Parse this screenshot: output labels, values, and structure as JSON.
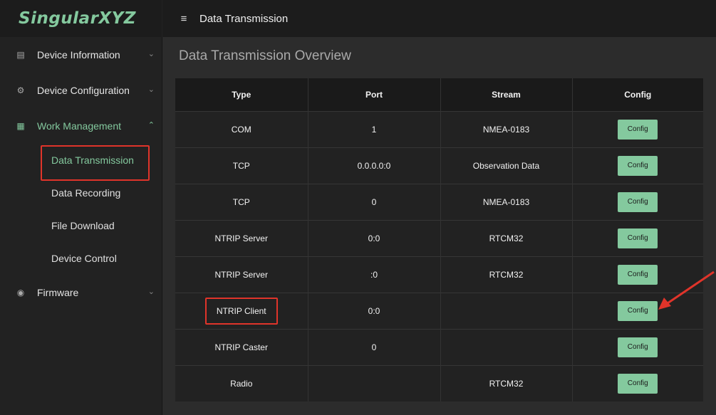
{
  "app": {
    "logo": "SingularXYZ",
    "top_title": "Data Transmission"
  },
  "sidebar": {
    "groups": [
      {
        "label": "Device Information",
        "icon": "device-info-icon",
        "expanded": false
      },
      {
        "label": "Device Configuration",
        "icon": "gear-icon",
        "expanded": false
      },
      {
        "label": "Work Management",
        "icon": "work-icon",
        "expanded": true,
        "children": [
          "Data Transmission",
          "Data Recording",
          "File Download",
          "Device Control"
        ],
        "active_child": "Data Transmission"
      },
      {
        "label": "Firmware",
        "icon": "firmware-icon",
        "expanded": false
      }
    ]
  },
  "main": {
    "title": "Data Transmission Overview",
    "columns": [
      "Type",
      "Port",
      "Stream",
      "Config"
    ],
    "rows": [
      {
        "type": "COM",
        "port": "1",
        "stream": "NMEA-0183",
        "config": "Config"
      },
      {
        "type": "TCP",
        "port": "0.0.0.0:0",
        "stream": "Observation Data",
        "config": "Config"
      },
      {
        "type": "TCP",
        "port": "0",
        "stream": "NMEA-0183",
        "config": "Config"
      },
      {
        "type": "NTRIP Server",
        "port": "0:0",
        "stream": "RTCM32",
        "config": "Config"
      },
      {
        "type": "NTRIP Server",
        "port": ":0",
        "stream": "RTCM32",
        "config": "Config"
      },
      {
        "type": "NTRIP Client",
        "port": "0:0",
        "stream": "",
        "config": "Config"
      },
      {
        "type": "NTRIP Caster",
        "port": "0",
        "stream": "",
        "config": "Config"
      },
      {
        "type": "Radio",
        "port": "",
        "stream": "RTCM32",
        "config": "Config"
      }
    ]
  },
  "colors": {
    "accent": "#84c99e",
    "highlight": "#e0342a",
    "background": "#2c2c2c"
  }
}
